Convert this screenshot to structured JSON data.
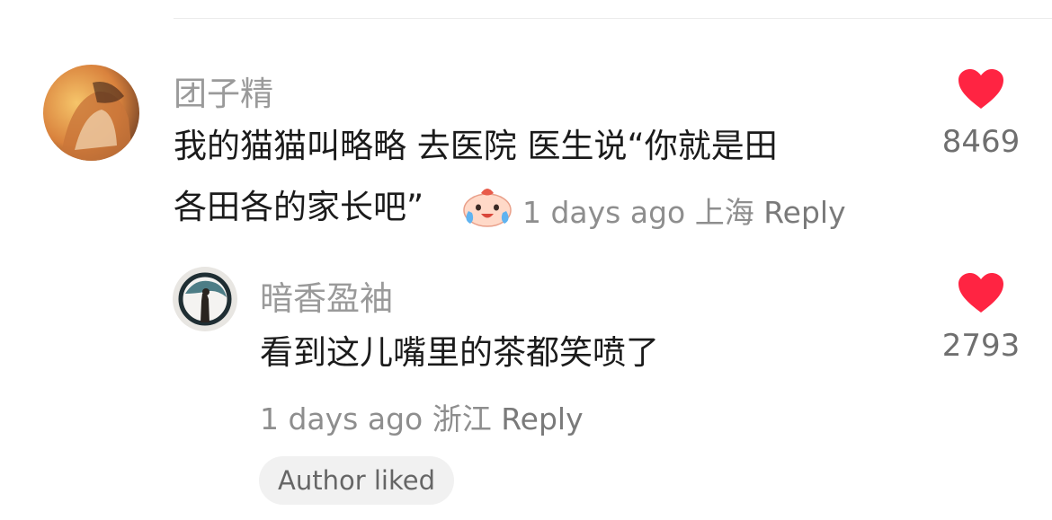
{
  "comments": [
    {
      "username": "团子精",
      "text_line1": "我的猫猫叫略略 去医院 医生说“你就是田",
      "text_line2": "各田各的家长吧”",
      "time": "1 days ago",
      "location": "上海",
      "reply_label": "Reply",
      "likes": "8469",
      "emoji_icon": "crying-laughing-bun-emoji"
    },
    {
      "username": "暗香盈袖",
      "text_line1": "看到这儿嘴里的茶都笑喷了",
      "time": "1 days ago",
      "location": "浙江",
      "reply_label": "Reply",
      "likes": "2793",
      "author_liked_label": "Author liked"
    }
  ],
  "colors": {
    "heart": "#ff2442",
    "muted_text": "#9a9a9a",
    "author_liked_bg": "#f1f1f1"
  }
}
